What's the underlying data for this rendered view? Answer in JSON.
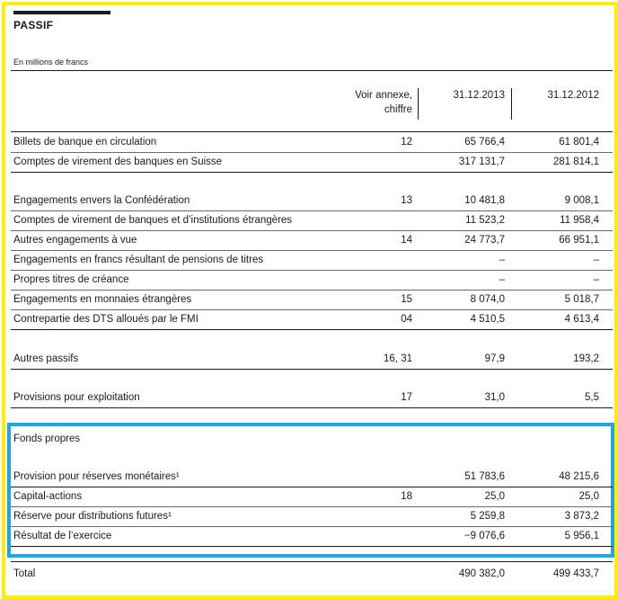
{
  "header": {
    "title": "PASSIF",
    "unit": "En millions de francs",
    "col_annex_line1": "Voir annexe,",
    "col_annex_line2": "chiffre",
    "col_2013": "31.12.2013",
    "col_2012": "31.12.2012"
  },
  "rows": [
    {
      "label": "Billets de banque en circulation",
      "annex": "12",
      "v2013": "65 766,4",
      "v2012": "61 801,4"
    },
    {
      "label": "Comptes de virement des banques en Suisse",
      "annex": "",
      "v2013": "317 131,7",
      "v2012": "281 814,1"
    },
    {
      "label": "Engagements envers la Confédération",
      "annex": "13",
      "v2013": "10 481,8",
      "v2012": "9 008,1"
    },
    {
      "label": "Comptes de virement de banques et d’institutions étrangères",
      "annex": "",
      "v2013": "11 523,2",
      "v2012": "11 958,4"
    },
    {
      "label": "Autres engagements à vue",
      "annex": "14",
      "v2013": "24 773,7",
      "v2012": "66 951,1"
    },
    {
      "label": "Engagements en francs résultant de pensions de titres",
      "annex": "",
      "v2013": "–",
      "v2012": "–"
    },
    {
      "label": "Propres titres de créance",
      "annex": "",
      "v2013": "–",
      "v2012": "–"
    },
    {
      "label": "Engagements en monnaies étrangères",
      "annex": "15",
      "v2013": "8 074,0",
      "v2012": "5 018,7"
    },
    {
      "label": "Contrepartie des DTS alloués par le FMI",
      "annex": "04",
      "v2013": "4 510,5",
      "v2012": "4 613,4"
    },
    {
      "label": "Autres passifs",
      "annex": "16, 31",
      "v2013": "97,9",
      "v2012": "193,2"
    },
    {
      "label": "Provisions pour exploitation",
      "annex": "17",
      "v2013": "31,0",
      "v2012": "5,5"
    }
  ],
  "equity": {
    "title": "Fonds propres",
    "rows": [
      {
        "label": "Provision pour réserves monétaires¹",
        "annex": "",
        "v2013": "51 783,6",
        "v2012": "48 215,6"
      },
      {
        "label": "Capital-actions",
        "annex": "18",
        "v2013": "25,0",
        "v2012": "25,0"
      },
      {
        "label": "Réserve pour distributions futures¹",
        "annex": "",
        "v2013": "5 259,8",
        "v2012": "3 873,2"
      },
      {
        "label": "Résultat de l’exercice",
        "annex": "",
        "v2013": "−9 076,6",
        "v2012": "5 956,1"
      }
    ]
  },
  "total": {
    "label": "Total",
    "v2013": "490 382,0",
    "v2012": "499 433,7"
  }
}
